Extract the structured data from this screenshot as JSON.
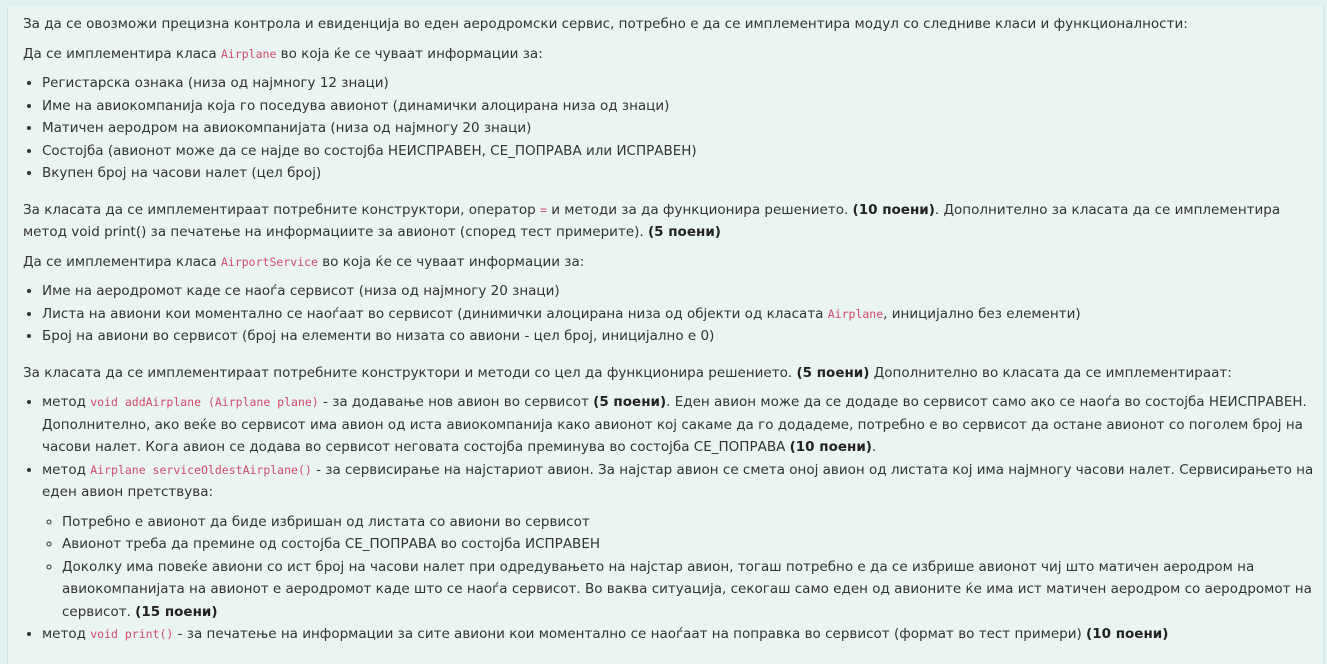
{
  "intro": "За да се овозможи прецизна контрола и евиденција во еден аеродромски сервис, потребно е да се имплементира модул со следниве класи и функционалности:",
  "airplane": {
    "intro_before": "Да се имплементира класа ",
    "class_name": "Airplane",
    "intro_after": " во која ќе се чуваат информации за:",
    "fields": [
      "Регистарска ознака (низа од најмногу 12 знаци)",
      "Име на авиокомпанија која го поседува авионот (динамички алоцирана низа од знаци)",
      "Матичен аеродром на авиокомпанијата (низа од најмногу 20 знаци)",
      "Состојба (авионот може да се најде во состојба НЕИСПРАВЕН, СЕ_ПОПРАВА или ИСПРАВЕН)",
      "Вкупен број на часови налет (цел број)"
    ],
    "para_part1": "За класата да се имплементираат потребните конструктори, оператор ",
    "operator": "=",
    "para_part2": " и методи за да функционира решението. ",
    "points1": "(10 поени)",
    "para_part3": ". Дополнително за класата да се имплементира метод void print() за печатење на информациите за авионот (според тест примерите). ",
    "points2": "(5 поени)"
  },
  "service": {
    "intro_before": "Да се имплементира класа ",
    "class_name": "AirportService",
    "intro_after": " во која ќе се чуваат информации за:",
    "field1": "Име на аеродромот каде се наоѓа сервисот (низа од најмногу 20 знаци)",
    "field2_before": "Листа на авиони кои моментално се наоѓаат во сервисот (динимички алоцирана низа од објекти од класата ",
    "field2_code": "Airplane",
    "field2_after": ", иницијално без елементи)",
    "field3": "Број на авиони во сервисот (број на елементи во низата со авиони - цел број, иницијално е 0)",
    "para_before": "За класата да се имплементираат потребните конструктори и методи со цел да функционира решението. ",
    "para_points": "(5 поени)",
    "para_after": " Дополнително во класата да се имплементираат:"
  },
  "methods": {
    "m1_prefix": "метод ",
    "m1_sig": "void addAirplane (Airplane plane)",
    "m1_text1": " - за додавање нов авион во сервисот ",
    "m1_points1": "(5 поени)",
    "m1_text2": ". Еден авион може да се додаде во сервисот само ако се наоѓа во состојба НЕИСПРАВЕН. Дополнително, ако веќе во сервисот има авион од иста авиокомпанија како авионот кој сакаме да го додадеме, потребно е во сервисот да остане авионот со поголем број на часови налет. Кога авион се додава во сервисот неговата состојба преминува во состојба СЕ_ПОПРАВА ",
    "m1_points2": "(10 поени)",
    "m1_end": ".",
    "m2_prefix": "метод ",
    "m2_sig": "Airplane serviceOldestAirplane()",
    "m2_text": " - за сервисирање на најстариот авион. За најстар авион се смета оној авион од листата кој има најмногу часови налет. Сервисирањето на еден авион претствува:",
    "m2_sub1": "Потребно е авионот да биде избришан од листата со авиони во сервисот",
    "m2_sub2": "Авионот треба да премине од состојба СЕ_ПОПРАВА во состојба ИСПРАВЕН",
    "m2_sub3_text": "Доколку има повеќе авиони со ист број на часови налет при одредувањето на најстар авион, тогаш потребно е да се избрише авионот чиј што матичен аеродром на авиокомпанијата на авионот е аеродромот каде што се наоѓа сервисот. Во ваква ситуација, секогаш само еден од авионите ќе има ист матичен аеродром со аеродромот на сервисот.  ",
    "m2_sub3_points": "(15 поени)",
    "m3_prefix": "метод ",
    "m3_sig": "void print()",
    "m3_text": " - за печатење на информации за сите авиони кои моментално се наоѓаат на поправка во сервисот (формат во тест примери) ",
    "m3_points": "(10 поени)"
  }
}
